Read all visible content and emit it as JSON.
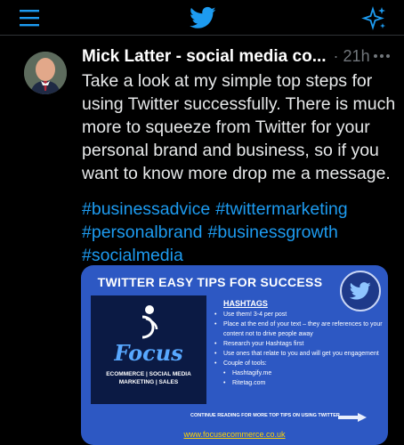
{
  "topbar": {
    "icons": [
      "menu-icon",
      "twitter-bird-icon",
      "sparkle-icon"
    ],
    "accent": "#1d9bf0"
  },
  "tweet": {
    "author_name": "Mick Latter - social media co...",
    "meta": "· 21h",
    "more_label": "···",
    "body": "Take a look at my simple top steps for using Twitter successfully. There is much more to squeeze from Twitter for your personal brand and business, so if you want to know more drop me a message.",
    "hashtags": [
      "#businessadvice",
      "#twittermarketing",
      "#personalbrand",
      "#businessgrowth",
      "#socialmedia"
    ]
  },
  "card": {
    "title": "TWITTER EASY TIPS  FOR SUCCESS",
    "brand_word": "Focus",
    "brand_tagline_1": "ECOMMERCE | SOCIAL MEDIA",
    "brand_tagline_2": "MARKETING | SALES",
    "tips_heading": "HASHTAGS",
    "tips": [
      "Use them! 3-4 per post",
      "Place at the end of your text – they are references to your content not to drive people away",
      "Research your Hashtags first",
      "Use ones that relate to you and will get you engagement",
      "Couple of tools:"
    ],
    "tools": [
      "Hashtagify.me",
      "Ritetag.com"
    ],
    "continue_text": "CONTINUE READING FOR MORE TOP TIPS ON USING TWITTER",
    "website": "www.focusecommerce.co.uk",
    "background": "#2d58c3"
  }
}
